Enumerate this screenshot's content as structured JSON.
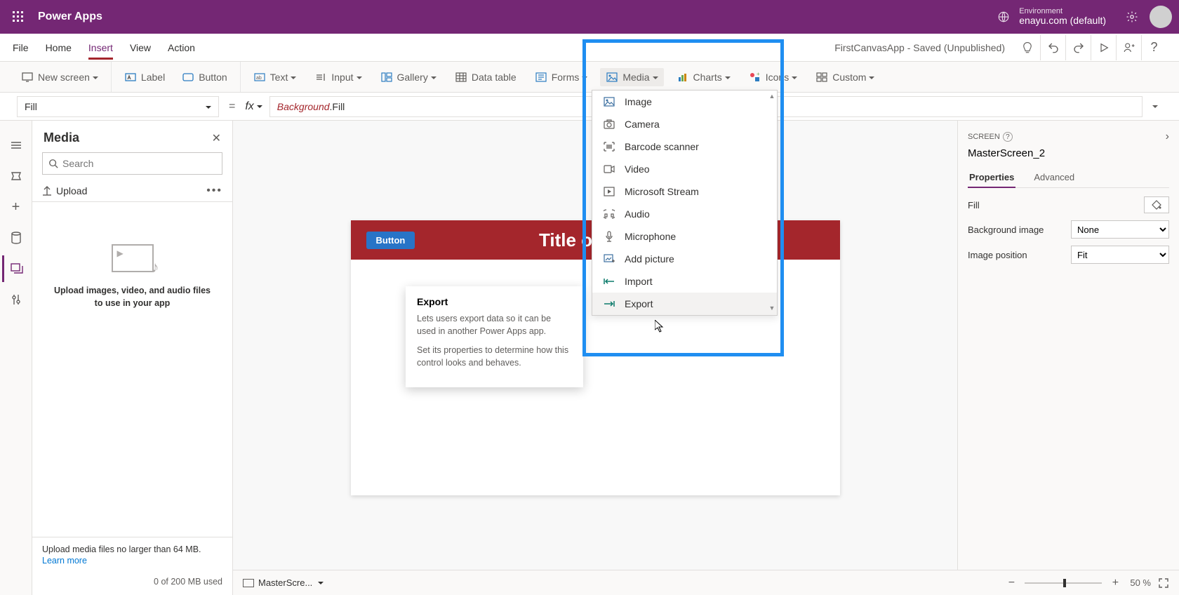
{
  "header": {
    "app_title": "Power Apps",
    "env_label": "Environment",
    "env_name": "enayu.com (default)"
  },
  "menu": {
    "items": [
      "File",
      "Home",
      "Insert",
      "View",
      "Action"
    ],
    "active_index": 2,
    "save_status": "FirstCanvasApp - Saved (Unpublished)"
  },
  "ribbon": {
    "new_screen": "New screen",
    "label": "Label",
    "button": "Button",
    "text": "Text",
    "input": "Input",
    "gallery": "Gallery",
    "data_table": "Data table",
    "forms": "Forms",
    "media": "Media",
    "charts": "Charts",
    "icons": "Icons",
    "custom": "Custom"
  },
  "formula": {
    "property": "Fill",
    "eq": "=",
    "fx": "fx",
    "class": "Background",
    "prop": ".Fill"
  },
  "left_panel": {
    "title": "Media",
    "search_placeholder": "Search",
    "upload": "Upload",
    "empty_text": "Upload images, video, and audio files to use in your app",
    "footer_text": "Upload media files no larger than 64 MB.",
    "learn_more": "Learn more",
    "usage": "0 of 200 MB used"
  },
  "canvas": {
    "button_label": "Button",
    "title_text": "Title of the Sc"
  },
  "tooltip": {
    "title": "Export",
    "body1": "Lets users export data so it can be used in another Power Apps app.",
    "body2": "Set its properties to determine how this control looks and behaves."
  },
  "media_dropdown": {
    "items": [
      {
        "label": "Image",
        "icon": "image-icon"
      },
      {
        "label": "Camera",
        "icon": "camera-icon"
      },
      {
        "label": "Barcode scanner",
        "icon": "barcode-icon"
      },
      {
        "label": "Video",
        "icon": "video-icon"
      },
      {
        "label": "Microsoft Stream",
        "icon": "stream-icon"
      },
      {
        "label": "Audio",
        "icon": "audio-icon"
      },
      {
        "label": "Microphone",
        "icon": "microphone-icon"
      },
      {
        "label": "Add picture",
        "icon": "add-picture-icon"
      },
      {
        "label": "Import",
        "icon": "import-icon"
      },
      {
        "label": "Export",
        "icon": "export-icon"
      }
    ],
    "hover_index": 9
  },
  "right_panel": {
    "label": "SCREEN",
    "name": "MasterScreen_2",
    "tabs": [
      "Properties",
      "Advanced"
    ],
    "active_tab": 0,
    "fill_label": "Fill",
    "bg_label": "Background image",
    "bg_value": "None",
    "imgpos_label": "Image position",
    "imgpos_value": "Fit"
  },
  "status": {
    "screen_name": "MasterScre...",
    "zoom": "50  %"
  }
}
